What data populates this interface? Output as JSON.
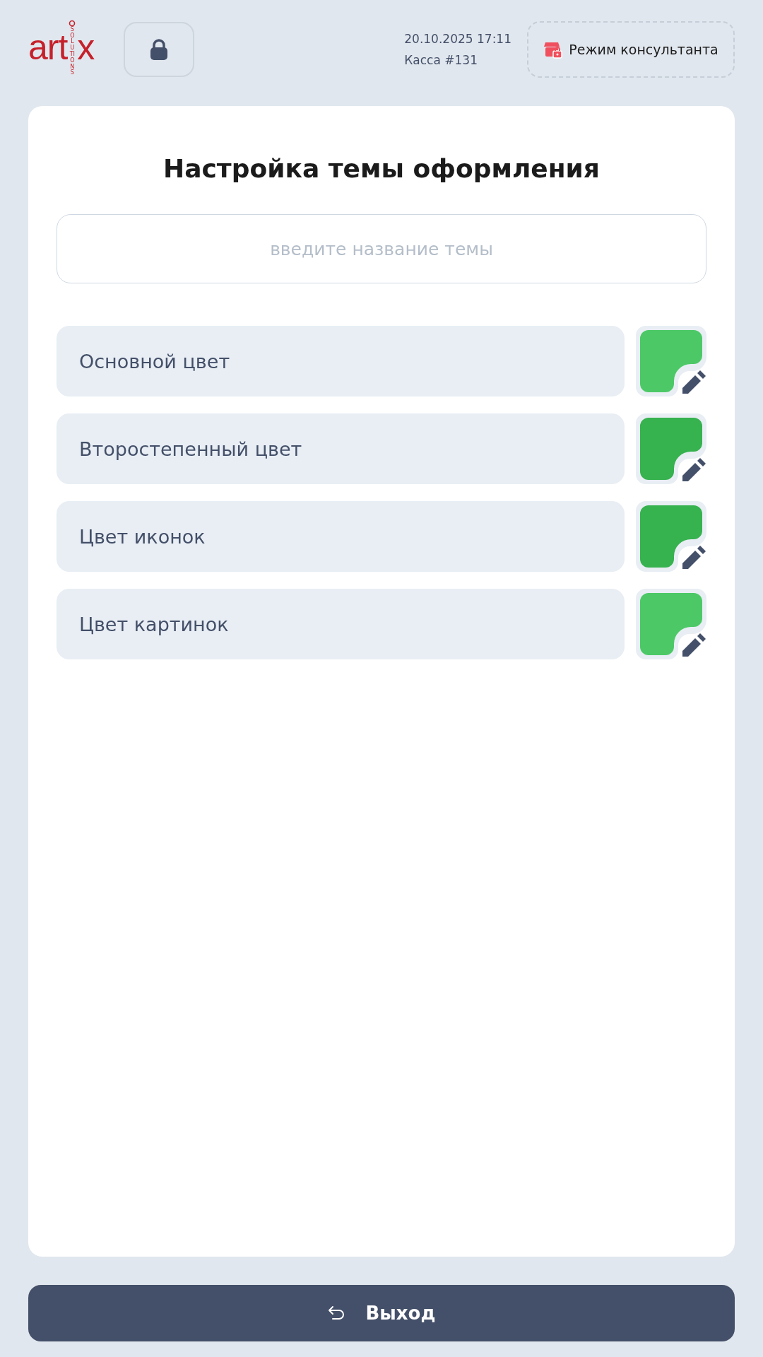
{
  "header": {
    "logo": {
      "word": "art",
      "tail": "x",
      "sub": "SOLUTIONS"
    },
    "datetime": "20.10.2025 17:11",
    "register": "Касса #131",
    "consultant_button": "Режим консультанта"
  },
  "title": "Настройка темы оформления",
  "theme_name": {
    "placeholder": "введите название темы"
  },
  "colors": [
    {
      "label": "Основной цвет",
      "color": "#4cc966"
    },
    {
      "label": "Второстепенный цвет",
      "color": "#36b24f"
    },
    {
      "label": "Цвет иконок",
      "color": "#36b24f"
    },
    {
      "label": "Цвет картинок",
      "color": "#4cc966"
    }
  ],
  "exit_button": "Выход"
}
